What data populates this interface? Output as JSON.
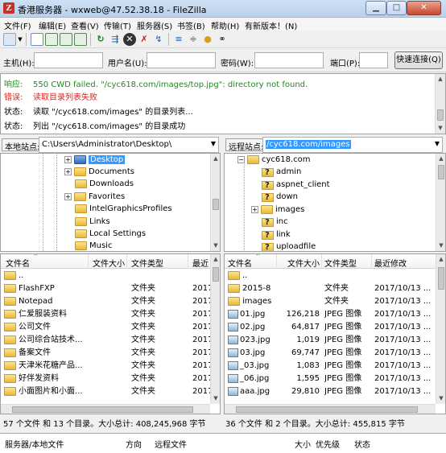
{
  "window": {
    "app_icon": "Z",
    "title": "香港服务器 - wxweb@47.52.38.18 - FileZilla",
    "min_icon": "minimize-icon",
    "max_icon": "maximize-icon",
    "close_icon": "close-icon",
    "min_glyph": "▁",
    "max_glyph": "□",
    "close_glyph": "✕"
  },
  "menu": [
    "文件(F)",
    "编辑(E)",
    "查看(V)",
    "传输(T)",
    "服务器(S)",
    "书签(B)",
    "帮助(H)",
    "有新版本！(N)"
  ],
  "toolbar": {
    "icons": [
      "site-manager-icon",
      "toggle-log-icon",
      "toggle-local-tree-icon",
      "toggle-remote-tree-icon",
      "toggle-queue-icon",
      "refresh-icon",
      "process-queue-icon",
      "cancel-icon",
      "disconnect-icon",
      "reconnect-icon",
      "filter-icon",
      "compare-icon",
      "sync-browse-icon",
      "search-icon"
    ]
  },
  "quickconnect": {
    "host_label": "主机(H):",
    "user_label": "用户名(U):",
    "pass_label": "密码(W):",
    "port_label": "端口(P):",
    "host_value": "",
    "user_value": "",
    "pass_value": "",
    "port_value": "",
    "button_label": "快速连接(Q)"
  },
  "log": [
    {
      "kind": "响应:",
      "text": "550 CWD failed. \"/cyc618.com/images/top.jpg\": directory not found.",
      "color": "#1e8a1e"
    },
    {
      "kind": "错误:",
      "text": "读取目录列表失败",
      "color": "#e02020"
    },
    {
      "kind": "状态:",
      "text": "读取 \"/cyc618.com/images\" 的目录列表...",
      "color": "#000000"
    },
    {
      "kind": "状态:",
      "text": "列出 \"/cyc618.com/images\" 的目录成功",
      "color": "#000000"
    }
  ],
  "local": {
    "site_label": "本地站点:",
    "path": "C:\\Users\\Administrator\\Desktop\\",
    "tree": [
      {
        "label": "Desktop",
        "selected": true,
        "expander": "+"
      },
      {
        "label": "Documents",
        "expander": "+"
      },
      {
        "label": "Downloads",
        "expander": ""
      },
      {
        "label": "Favorites",
        "expander": "+"
      },
      {
        "label": "IntelGraphicsProfiles",
        "expander": ""
      },
      {
        "label": "Links",
        "expander": ""
      },
      {
        "label": "Local Settings",
        "expander": ""
      },
      {
        "label": "Music",
        "expander": ""
      }
    ],
    "columns": [
      "文件名",
      "文件大小",
      "文件类型",
      "最近"
    ],
    "files": [
      {
        "name": "..",
        "size": "",
        "type": "",
        "date": ""
      },
      {
        "name": "FlashFXP",
        "size": "",
        "type": "文件夹",
        "date": "2017"
      },
      {
        "name": "Notepad",
        "size": "",
        "type": "文件夹",
        "date": "2017"
      },
      {
        "name": "仁爱服装资料",
        "size": "",
        "type": "文件夹",
        "date": "2017"
      },
      {
        "name": "公司文件",
        "size": "",
        "type": "文件夹",
        "date": "2017"
      },
      {
        "name": "公司综合站技术...",
        "size": "",
        "type": "文件夹",
        "date": "2017"
      },
      {
        "name": "备案文件",
        "size": "",
        "type": "文件夹",
        "date": "2017"
      },
      {
        "name": "天津米花糖产品...",
        "size": "",
        "type": "文件夹",
        "date": "2017"
      },
      {
        "name": "好伴发资料",
        "size": "",
        "type": "文件夹",
        "date": "2017"
      },
      {
        "name": "小面图片和小面...",
        "size": "",
        "type": "文件夹",
        "date": "2017"
      }
    ],
    "status": "57 个文件 和 13 个目录。大小总计: 408,245,968 字节"
  },
  "remote": {
    "site_label": "远程站点:",
    "path": "/cyc618.com/images",
    "tree": [
      {
        "label": "cyc618.com",
        "depth": 0,
        "expander": "−",
        "type": "folder"
      },
      {
        "label": "admin",
        "depth": 1,
        "expander": "",
        "type": "unknown"
      },
      {
        "label": "aspnet_client",
        "depth": 1,
        "expander": "",
        "type": "unknown"
      },
      {
        "label": "down",
        "depth": 1,
        "expander": "",
        "type": "unknown"
      },
      {
        "label": "images",
        "depth": 1,
        "expander": "+",
        "type": "folder"
      },
      {
        "label": "inc",
        "depth": 1,
        "expander": "",
        "type": "unknown"
      },
      {
        "label": "link",
        "depth": 1,
        "expander": "",
        "type": "unknown"
      },
      {
        "label": "uploadfile",
        "depth": 1,
        "expander": "",
        "type": "unknown"
      }
    ],
    "columns": [
      "文件名",
      "文件大小",
      "文件类型",
      "最近修改"
    ],
    "files": [
      {
        "name": "..",
        "size": "",
        "type": "",
        "date": "",
        "kind": "folder"
      },
      {
        "name": "2015-8",
        "size": "",
        "type": "文件夹",
        "date": "2017/10/13 ...",
        "kind": "folder"
      },
      {
        "name": "images",
        "size": "",
        "type": "文件夹",
        "date": "2017/10/13 ...",
        "kind": "folder"
      },
      {
        "name": "01.jpg",
        "size": "126,218",
        "type": "JPEG 图像",
        "date": "2017/10/13 ...",
        "kind": "image"
      },
      {
        "name": "02.jpg",
        "size": "64,817",
        "type": "JPEG 图像",
        "date": "2017/10/13 ...",
        "kind": "image"
      },
      {
        "name": "023.jpg",
        "size": "1,019",
        "type": "JPEG 图像",
        "date": "2017/10/13 ...",
        "kind": "image"
      },
      {
        "name": "03.jpg",
        "size": "69,747",
        "type": "JPEG 图像",
        "date": "2017/10/13 ...",
        "kind": "image"
      },
      {
        "name": "_03.jpg",
        "size": "1,083",
        "type": "JPEG 图像",
        "date": "2017/10/13 ...",
        "kind": "image"
      },
      {
        "name": "_06.jpg",
        "size": "1,595",
        "type": "JPEG 图像",
        "date": "2017/10/13 ...",
        "kind": "image"
      },
      {
        "name": "aaa.jpg",
        "size": "29,810",
        "type": "JPEG 图像",
        "date": "2017/10/13 ...",
        "kind": "image"
      }
    ],
    "status": "36 个文件 和 2 个目录。大小总计: 455,815 字节"
  },
  "queue": {
    "columns": [
      "服务器/本地文件",
      "方向",
      "远程文件",
      "大小",
      "优先级",
      "状态"
    ]
  },
  "colors": {
    "selection": "#3399ff",
    "response": "#1e8a1e",
    "error": "#e02020"
  }
}
